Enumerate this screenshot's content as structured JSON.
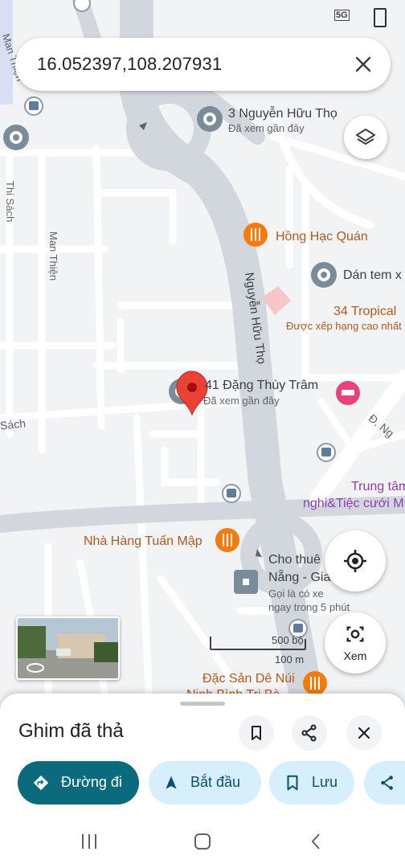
{
  "status_bar": {
    "network": "5G"
  },
  "search": {
    "query": "16.052397,108.207931"
  },
  "map": {
    "streets": [
      {
        "id": "man-thien-top",
        "text": "Man Thiện"
      },
      {
        "id": "thi-sach",
        "text": "Thi Sách"
      },
      {
        "id": "man-thien",
        "text": "Man Thiện"
      },
      {
        "id": "nguyen-huu-tho",
        "text": "Nguyễn Hữu Thọ"
      },
      {
        "id": "sach",
        "text": "Sách"
      },
      {
        "id": "dang-ng",
        "text": "Đ. Ng"
      }
    ],
    "places": {
      "nguyen_huu_tho_3": {
        "name": "3 Nguyễn Hữu Thọ",
        "sub": "Đã xem gần đây"
      },
      "hong_hac": {
        "name": "Hồng Hạc Quán"
      },
      "dan_tem": {
        "name": "Dán tem x"
      },
      "tropical": {
        "name": "34 Tropical",
        "sub": "Được xếp hạng cao nhất"
      },
      "dang_thuy_tram": {
        "name": "41 Đặng Thùy Trâm",
        "sub": "Đã xem gần đây"
      },
      "trung_tam": {
        "name": "Trung tâm",
        "sub": "nghi&Tiệc cưới M"
      },
      "tuan_map": {
        "name": "Nhà Hàng Tuấn Mập"
      },
      "cho_thue": {
        "name": "Cho thuê",
        "name2": "Nẵng - Gia",
        "sub1": "Gọi là có xe",
        "sub2": "ngay trong 5 phút"
      },
      "dac_san": {
        "name": "Đặc Sản Dê Núi",
        "name2": "Ninh Bình Tri Bà"
      }
    },
    "scale": {
      "label1": "500 bộ",
      "label2": "100 m"
    },
    "lens_label": "Xem",
    "colors": {
      "map_bg": "#f1f3f4",
      "road": "#ffffff",
      "major_road": "#d2d7de",
      "pin": "#ea4335",
      "food": "#f57c0c",
      "hotel": "#ec407a",
      "accent": "#0b6b7d"
    }
  },
  "sheet": {
    "title": "Ghim đã thả",
    "actions": [
      {
        "icon": "directions-icon",
        "label": "Đường đi"
      },
      {
        "icon": "navigation-icon",
        "label": "Bắt đầu"
      },
      {
        "icon": "bookmark-icon",
        "label": "Lưu"
      },
      {
        "icon": "share-icon",
        "label": ""
      }
    ]
  },
  "icons": [
    "close-icon",
    "layers-icon",
    "my-location-icon",
    "lens-icon",
    "bookmark-icon",
    "share-icon",
    "recents-icon",
    "home-icon",
    "back-icon"
  ]
}
